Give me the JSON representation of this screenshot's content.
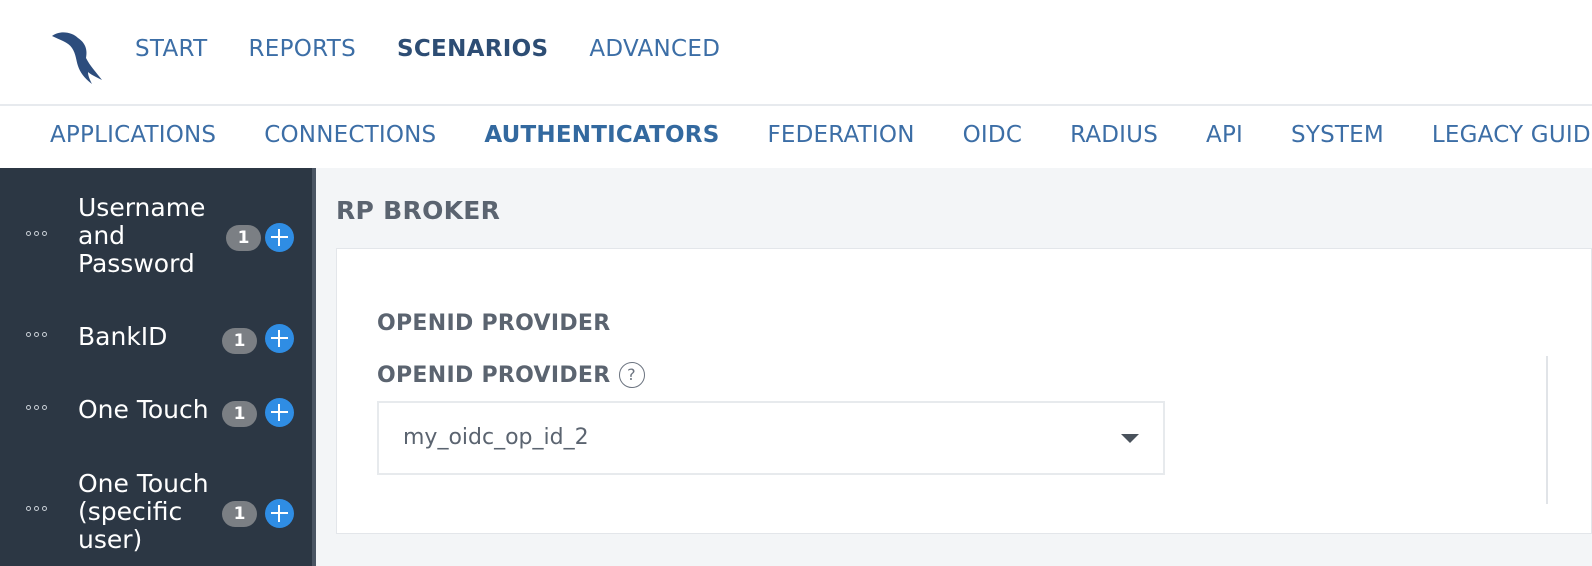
{
  "header": {
    "logo_icon": "bird-logo-icon",
    "nav": [
      {
        "label": "START",
        "active": false
      },
      {
        "label": "REPORTS",
        "active": false
      },
      {
        "label": "SCENARIOS",
        "active": true
      },
      {
        "label": "ADVANCED",
        "active": false
      }
    ]
  },
  "subnav": [
    {
      "label": "APPLICATIONS",
      "active": false
    },
    {
      "label": "CONNECTIONS",
      "active": false
    },
    {
      "label": "AUTHENTICATORS",
      "active": true
    },
    {
      "label": "FEDERATION",
      "active": false
    },
    {
      "label": "OIDC",
      "active": false
    },
    {
      "label": "RADIUS",
      "active": false
    },
    {
      "label": "API",
      "active": false
    },
    {
      "label": "SYSTEM",
      "active": false
    },
    {
      "label": "LEGACY GUIDES",
      "active": false
    }
  ],
  "sidebar": {
    "items": [
      {
        "label": "Username and Password",
        "lines": [
          "Username",
          "and",
          "Password"
        ],
        "count": "1"
      },
      {
        "label": "BankID",
        "lines": [
          "BankID"
        ],
        "count": "1"
      },
      {
        "label": "One Touch",
        "lines": [
          "One Touch"
        ],
        "count": "1"
      },
      {
        "label": "One Touch (specific user)",
        "lines": [
          "One Touch",
          "(specific",
          "user)"
        ],
        "count": "1"
      }
    ]
  },
  "main": {
    "title": "RP BROKER",
    "section_title": "OPENID PROVIDER",
    "field": {
      "label": "OPENID PROVIDER",
      "help_icon": "question-circle-icon",
      "help_glyph": "?",
      "selected_value": "my_oidc_op_id_2"
    }
  },
  "colors": {
    "accent": "#3c6ea6",
    "sidebar_bg": "#2c3744",
    "plus_button": "#2f8de4",
    "badge": "#7b7f84"
  }
}
